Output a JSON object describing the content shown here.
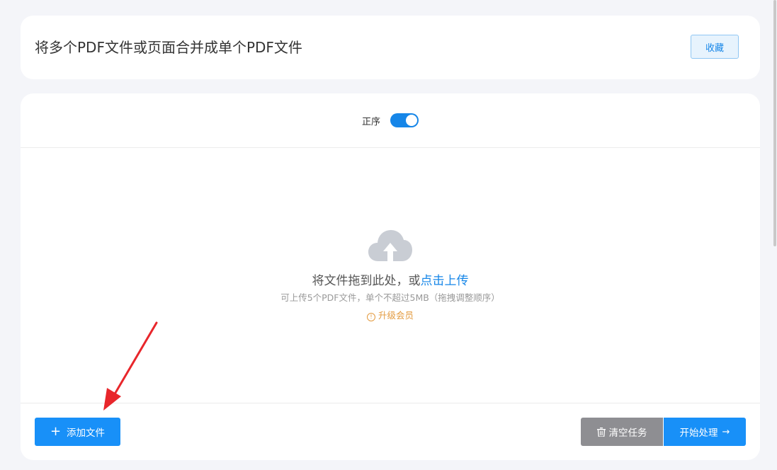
{
  "header": {
    "title": "将多个PDF文件或页面合并成单个PDF文件",
    "favorite_label": "收藏"
  },
  "order": {
    "label": "正序",
    "enabled": true
  },
  "drop_zone": {
    "text_prefix": "将文件拖到此处，或",
    "upload_link": "点击上传",
    "hint": "可上传5个PDF文件，单个不超过5MB（拖拽调整顺序）",
    "upgrade_label": "升级会员",
    "upgrade_icon": "!"
  },
  "footer": {
    "add_label": "添加文件",
    "clear_label": "清空任务",
    "start_label": "开始处理",
    "start_arrow": "→"
  },
  "colors": {
    "accent": "#1890f8",
    "gray_button": "#8e8e92",
    "upgrade": "#e39a3e",
    "annotation": "#e8262b"
  },
  "icons": [
    "cloud-upload-icon",
    "trash-icon",
    "plus-icon",
    "arrow-right-icon",
    "warning-circle-icon"
  ]
}
